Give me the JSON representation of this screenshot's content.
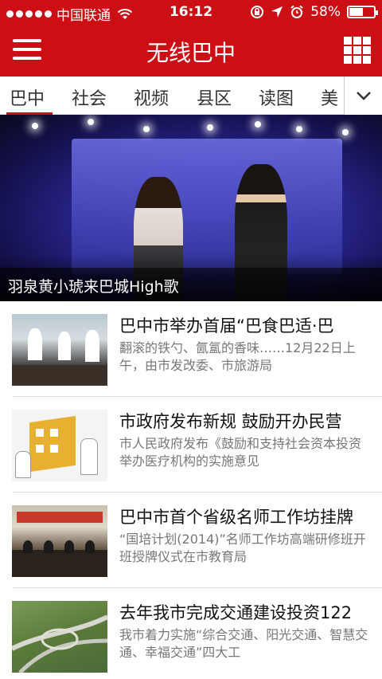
{
  "status_bar": {
    "carrier": "中国联通",
    "time": "16:12",
    "battery": "58%",
    "battery_level": 0.58
  },
  "header": {
    "title": "无线巴中",
    "menu_icon": "hamburger-menu-icon",
    "grid_icon": "app-grid-icon"
  },
  "tabs": [
    {
      "label": "巴中",
      "active": true
    },
    {
      "label": "社会"
    },
    {
      "label": "视频"
    },
    {
      "label": "县区"
    },
    {
      "label": "读图"
    },
    {
      "label": "美"
    }
  ],
  "hero": {
    "caption": "羽泉黄小琥来巴城High歌"
  },
  "news": [
    {
      "title": "巴中市举办首届“巴食巴适·巴",
      "summary": "翻滚的铁勺、氤氲的香味……12月22日上午，由市发改委、市旅游局",
      "thumb": "chefs-cooking-photo"
    },
    {
      "title": "市政府发布新规 鼓励开办民营",
      "summary": "市人民政府发布《鼓励和支持社会资本投资举办医疗机构的实施意见",
      "thumb": "hospital-cartoon-illustration"
    },
    {
      "title": "巴中市首个省级名师工作坊挂牌",
      "summary": "“国培计划(2014)”名师工作坊高端研修班开班授牌仪式在市教育局",
      "thumb": "meeting-room-photo"
    },
    {
      "title": "去年我市完成交通建设投资122",
      "summary": "我市着力实施“综合交通、阳光交通、智慧交通、幸福交通”四大工",
      "thumb": "highway-interchange-photo"
    }
  ],
  "colors": {
    "brand_red": "#cc0f15"
  }
}
